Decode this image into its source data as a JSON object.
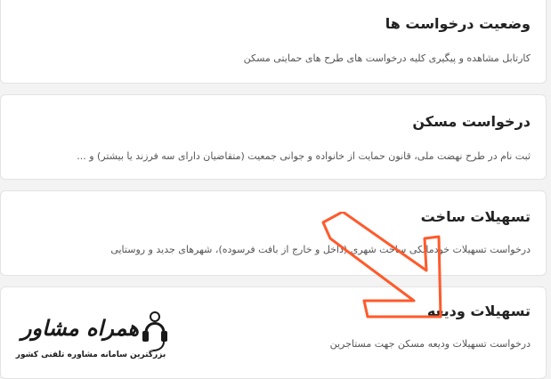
{
  "cards": [
    {
      "title": "وضعیت درخواست ها",
      "description": "کارتابل مشاهده و پیگیری کلیه درخواست های طرح های حمایتی مسکن"
    },
    {
      "title": "درخواست مسکن",
      "description": "ثبت نام در طرح نهضت ملی، قانون حمایت از خانواده و جوانی جمعیت (متقاضیان دارای سه فرزند یا بیشتر) و ..."
    },
    {
      "title": "تسهیلات ساخت",
      "description": "درخواست تسهیلات خودمالکی ساخت شهری (داخل و خارج از بافت فرسوده)، شهرهای جدید و روستایی"
    },
    {
      "title": "تسهیلات ودیعه",
      "description": "درخواست تسهیلات ودیعه مسکن جهت مستاجرین"
    }
  ],
  "watermark": {
    "name": "همراه مشاور",
    "tagline": "بزرگترین سامانه مشاوره تلفنی کشور",
    "icon": "phone-headset-icon"
  },
  "colors": {
    "arrow": "#ff5a2b",
    "card_bg": "#ffffff",
    "page_bg": "#f3f3f3"
  }
}
